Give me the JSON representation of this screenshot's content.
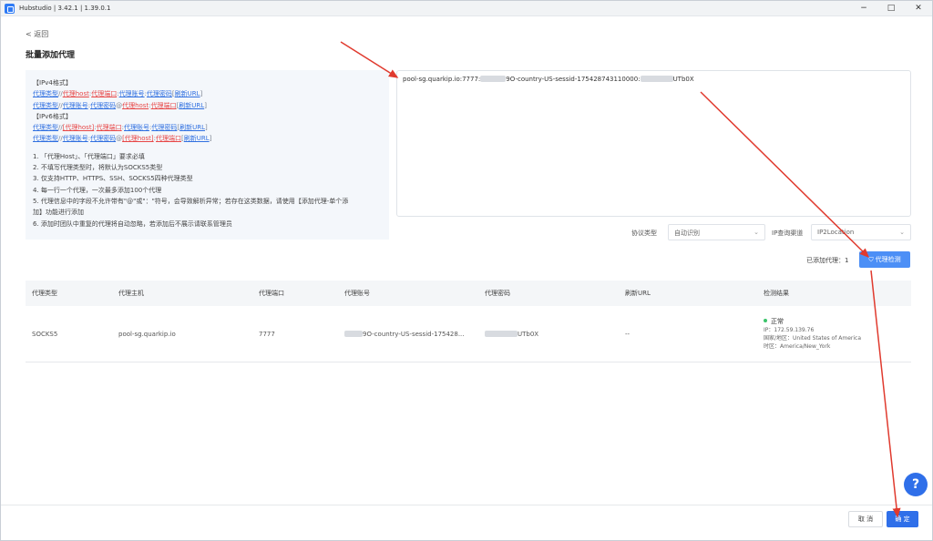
{
  "window": {
    "title": "Hubstudio | 3.42.1 | 1.39.0.1",
    "minimize": "−",
    "maximize": "□",
    "close": "✕"
  },
  "nav": {
    "back": "< 返回"
  },
  "page": {
    "title": "批量添加代理"
  },
  "help": {
    "ipv4_header": "【IPv4格式】",
    "ipv6_header": "【IPv6格式】",
    "tokens": {
      "type": "代理类型",
      "host": "代理host",
      "port": "代理端口",
      "account": "代理账号",
      "password": "代理密码",
      "refresh": "刷新URL",
      "host_bracket": "[代理host]"
    },
    "notes": [
      "1. 「代理Host」、「代理端口」要求必填",
      "2. 不填写代理类型时，将默认为SOCKS5类型",
      "3. 仅支持HTTP、HTTPS、SSH、SOCKS5四种代理类型",
      "4. 每一行一个代理，一次最多添加100个代理",
      "5. 代理信息中的字段不允许带有\"@\"或\"：\"符号，会导致解析异常；若存在这类数据，请使用【添加代理-单个添",
      "加】功能进行添加",
      "6. 添加时团队中重复的代理将自动忽略，若添加后不展示请联系管理员"
    ]
  },
  "input": {
    "prefix": "pool-sg.quarkip.io:7777:",
    "mid": "9O-country-US-sessid-175428743110000:",
    "suffix": "UTb0X"
  },
  "options": {
    "protocol_label": "协议类型",
    "protocol_value": "自动识别",
    "ip_channel_label": "IP查询渠道",
    "ip_channel_value": "IP2Location"
  },
  "summary": {
    "added_label": "已添加代理：",
    "added_count": "1",
    "check_button": "代理检测",
    "check_icon": "shield-check-icon"
  },
  "table": {
    "columns": [
      "代理类型",
      "代理主机",
      "代理端口",
      "代理账号",
      "代理密码",
      "刷新URL",
      "检测结果"
    ],
    "rows": [
      {
        "type": "SOCKS5",
        "host": "pool-sg.quarkip.io",
        "port": "7777",
        "account": "9O-country-US-sessid-175428...",
        "password": "UTb0X",
        "refresh": "--",
        "result_status": "正常",
        "result_ip": "IP：172.59.139.76",
        "result_region": "国家/地区：United States of America",
        "result_tz": "时区：America/New_York"
      }
    ]
  },
  "footer": {
    "cancel": "取 消",
    "confirm": "确 定"
  },
  "fab": {
    "label": "?"
  },
  "colors": {
    "primary": "#2f6fe9",
    "link": "#2f6fe0",
    "red": "#e74646",
    "annotation_arrow": "#e03a2e",
    "ok": "#3ac46a"
  }
}
